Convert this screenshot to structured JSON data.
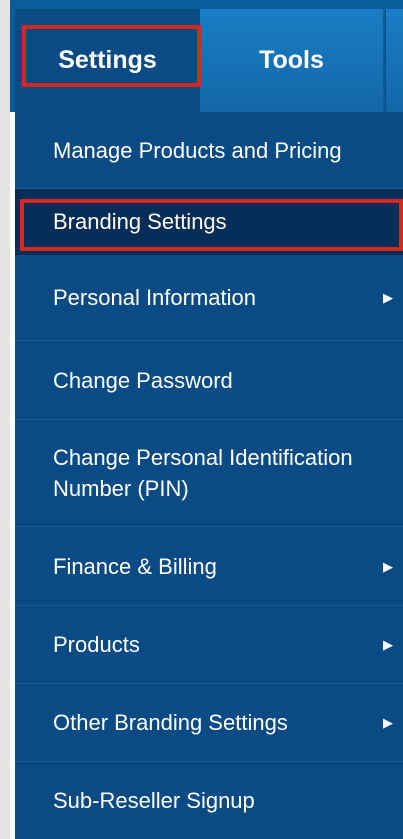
{
  "tabs": [
    {
      "label": "Settings",
      "active": true
    },
    {
      "label": "Tools",
      "active": false
    }
  ],
  "menu": {
    "items": [
      {
        "label": "Manage Products and Pricing",
        "has_submenu": false
      },
      {
        "label": "Branding Settings",
        "active": true,
        "has_submenu": false
      },
      {
        "label": "Personal Information",
        "has_submenu": true
      },
      {
        "label": "Change Password",
        "has_submenu": false
      },
      {
        "label": "Change Personal Identification Number (PIN)",
        "has_submenu": false
      },
      {
        "label": "Finance & Billing",
        "has_submenu": true
      },
      {
        "label": "Products",
        "has_submenu": true
      },
      {
        "label": "Other Branding Settings",
        "has_submenu": true
      },
      {
        "label": "Sub-Reseller Signup",
        "has_submenu": false
      }
    ],
    "submenu_arrow": "▶"
  },
  "colors": {
    "menu_bg": "#0a4b86",
    "active_bg": "#062d57",
    "tab_bg": "#1a7dc4",
    "highlight": "#d32a1c"
  }
}
